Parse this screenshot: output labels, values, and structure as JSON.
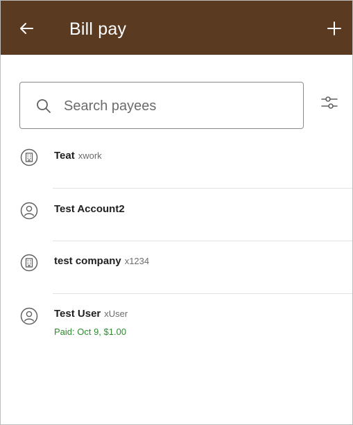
{
  "appbar": {
    "title": "Bill pay",
    "back_icon": "arrow-left-icon",
    "add_icon": "plus-icon",
    "background": "#5b3a22"
  },
  "search": {
    "placeholder": "Search payees",
    "value": "",
    "icon": "search-icon"
  },
  "filter": {
    "icon": "sliders-icon"
  },
  "payees": [
    {
      "type": "business",
      "icon": "building-icon",
      "name": "Teat",
      "account": "xwork",
      "paid": ""
    },
    {
      "type": "person",
      "icon": "person-icon",
      "name": "Test Account2",
      "account": "",
      "paid": ""
    },
    {
      "type": "business",
      "icon": "building-icon",
      "name": "test company",
      "account": "x1234",
      "paid": ""
    },
    {
      "type": "person",
      "icon": "person-icon",
      "name": "Test User",
      "account": "xUser",
      "paid": "Paid: Oct 9, $1.00"
    }
  ],
  "colors": {
    "paid_text": "#2e8b2e",
    "divider": "#e2e2e2"
  }
}
